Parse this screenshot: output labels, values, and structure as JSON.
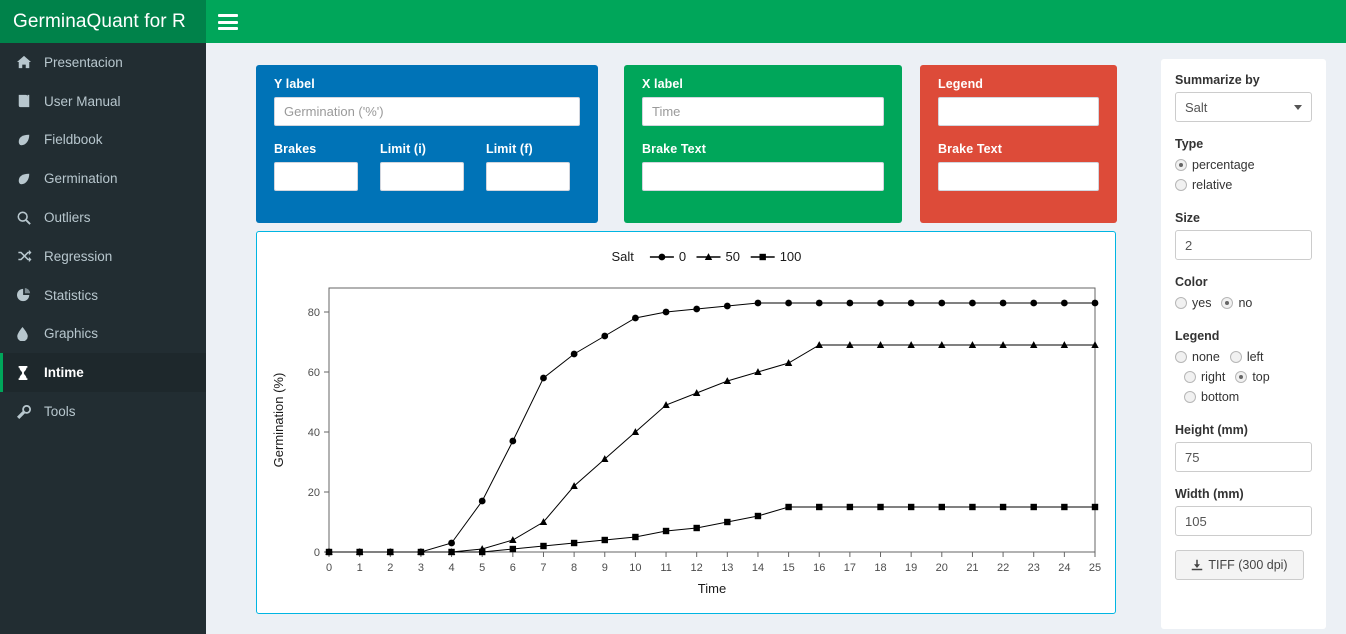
{
  "app": {
    "brand": "GerminaQuant for R",
    "menu_toggle_icon": "hamburger-icon"
  },
  "sidebar": {
    "items": [
      {
        "label": "Presentacion",
        "icon": "home-icon",
        "active": false
      },
      {
        "label": "User Manual",
        "icon": "book-icon",
        "active": false
      },
      {
        "label": "Fieldbook",
        "icon": "leaf-icon",
        "active": false
      },
      {
        "label": "Germination",
        "icon": "leaf-icon",
        "active": false
      },
      {
        "label": "Outliers",
        "icon": "search-icon",
        "active": false
      },
      {
        "label": "Regression",
        "icon": "shuffle-icon",
        "active": false
      },
      {
        "label": "Statistics",
        "icon": "pie-chart-icon",
        "active": false
      },
      {
        "label": "Graphics",
        "icon": "droplet-icon",
        "active": false
      },
      {
        "label": "Intime",
        "icon": "hourglass-icon",
        "active": true
      },
      {
        "label": "Tools",
        "icon": "wrench-icon",
        "active": false
      }
    ]
  },
  "panels": {
    "y_panel": {
      "color": "#0073b7",
      "title": "Y label",
      "ylabel_value": "",
      "ylabel_placeholder": "Germination ('%')",
      "brakes_label": "Brakes",
      "brakes_value": "",
      "limit_i_label": "Limit (i)",
      "limit_i_value": "",
      "limit_f_label": "Limit (f)",
      "limit_f_value": ""
    },
    "x_panel": {
      "color": "#00a65a",
      "title": "X label",
      "xlabel_value": "",
      "xlabel_placeholder": "Time",
      "brake_text_label": "Brake Text",
      "brake_text_value": ""
    },
    "legend_panel": {
      "color": "#dd4b39",
      "title": "Legend",
      "legend_value": "",
      "brake_text_label": "Brake Text",
      "brake_text_value": ""
    }
  },
  "options": {
    "summarize_by_label": "Summarize by",
    "summarize_by_value": "Salt",
    "type_label": "Type",
    "type_options": [
      {
        "label": "percentage",
        "selected": true
      },
      {
        "label": "relative",
        "selected": false
      }
    ],
    "size_label": "Size",
    "size_value": "2",
    "color_label": "Color",
    "color_options": [
      {
        "label": "yes",
        "selected": false
      },
      {
        "label": "no",
        "selected": true
      }
    ],
    "legend_label": "Legend",
    "legend_options": [
      {
        "label": "none",
        "selected": false
      },
      {
        "label": "left",
        "selected": false
      },
      {
        "label": "right",
        "selected": false
      },
      {
        "label": "top",
        "selected": true
      },
      {
        "label": "bottom",
        "selected": false
      }
    ],
    "height_label": "Height (mm)",
    "height_value": "75",
    "width_label": "Width (mm)",
    "width_value": "105",
    "download_label": "TIFF (300 dpi)",
    "download_icon": "download-icon"
  },
  "chart_data": {
    "type": "line",
    "title": "",
    "legend_title": "Salt",
    "legend_position": "top",
    "xlabel": "Time",
    "ylabel": "Germination (%)",
    "xlim": [
      0,
      25
    ],
    "ylim": [
      0,
      88
    ],
    "xticks": [
      0,
      1,
      2,
      3,
      4,
      5,
      6,
      7,
      8,
      9,
      10,
      11,
      12,
      13,
      14,
      15,
      16,
      17,
      18,
      19,
      20,
      21,
      22,
      23,
      24,
      25
    ],
    "yticks": [
      0,
      20,
      40,
      60,
      80
    ],
    "grid": false,
    "x": [
      0,
      1,
      2,
      3,
      4,
      5,
      6,
      7,
      8,
      9,
      10,
      11,
      12,
      13,
      14,
      15,
      16,
      17,
      18,
      19,
      20,
      21,
      22,
      23,
      24,
      25
    ],
    "series": [
      {
        "name": "0",
        "marker": "circle",
        "values": [
          0,
          0,
          0,
          0,
          3,
          17,
          37,
          58,
          66,
          72,
          78,
          80,
          81,
          82,
          83,
          83,
          83,
          83,
          83,
          83,
          83,
          83,
          83,
          83,
          83,
          83
        ]
      },
      {
        "name": "50",
        "marker": "triangle",
        "values": [
          0,
          0,
          0,
          0,
          0,
          1,
          4,
          10,
          22,
          31,
          40,
          49,
          53,
          57,
          60,
          63,
          69,
          69,
          69,
          69,
          69,
          69,
          69,
          69,
          69,
          69
        ]
      },
      {
        "name": "100",
        "marker": "square",
        "values": [
          0,
          0,
          0,
          0,
          0,
          0,
          1,
          2,
          3,
          4,
          5,
          7,
          8,
          10,
          12,
          15,
          15,
          15,
          15,
          15,
          15,
          15,
          15,
          15,
          15,
          15
        ]
      }
    ]
  }
}
